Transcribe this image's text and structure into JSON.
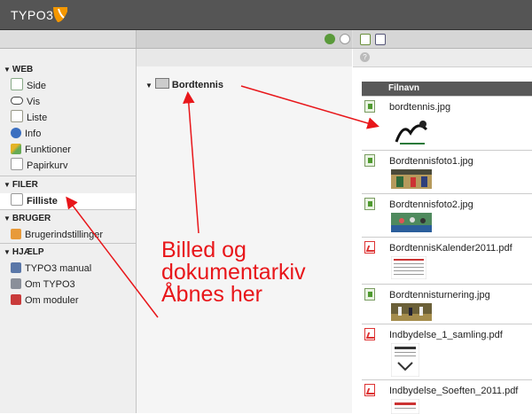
{
  "topbar": {
    "logo": "TYPO3"
  },
  "modules": {
    "groups": [
      {
        "title": "WEB",
        "items": [
          {
            "label": "Side",
            "icon": "page-module-icon"
          },
          {
            "label": "Vis",
            "icon": "eye-icon"
          },
          {
            "label": "Liste",
            "icon": "list-icon"
          },
          {
            "label": "Info",
            "icon": "info-icon"
          },
          {
            "label": "Funktioner",
            "icon": "wand-icon"
          },
          {
            "label": "Papirkurv",
            "icon": "trash-icon"
          }
        ]
      },
      {
        "title": "FILER",
        "items": [
          {
            "label": "Filliste",
            "icon": "folder-list-icon"
          }
        ]
      },
      {
        "title": "BRUGER",
        "items": [
          {
            "label": "Brugerindstillinger",
            "icon": "user-settings-icon"
          }
        ]
      },
      {
        "title": "HJÆLP",
        "items": [
          {
            "label": "TYPO3 manual",
            "icon": "manual-icon"
          },
          {
            "label": "Om TYPO3",
            "icon": "about-icon"
          },
          {
            "label": "Om moduler",
            "icon": "about-modules-icon"
          }
        ]
      }
    ]
  },
  "tree": {
    "root": "Bordtennis"
  },
  "filelist": {
    "column": "Filnavn",
    "files": [
      {
        "name": "bordtennis.jpg",
        "type": "img"
      },
      {
        "name": "Bordtennisfoto1.jpg",
        "type": "img"
      },
      {
        "name": "Bordtennisfoto2.jpg",
        "type": "img"
      },
      {
        "name": "BordtennisKalender2011.pdf",
        "type": "pdf"
      },
      {
        "name": "Bordtennisturnering.jpg",
        "type": "img"
      },
      {
        "name": "Indbydelse_1_samling.pdf",
        "type": "pdf"
      },
      {
        "name": "Indbydelse_Soeften_2011.pdf",
        "type": "pdf"
      }
    ]
  },
  "annotation": {
    "line1": "Billed og",
    "line2": "dokumentarkiv",
    "line3": "Åbnes her",
    "color": "#e8161a"
  }
}
